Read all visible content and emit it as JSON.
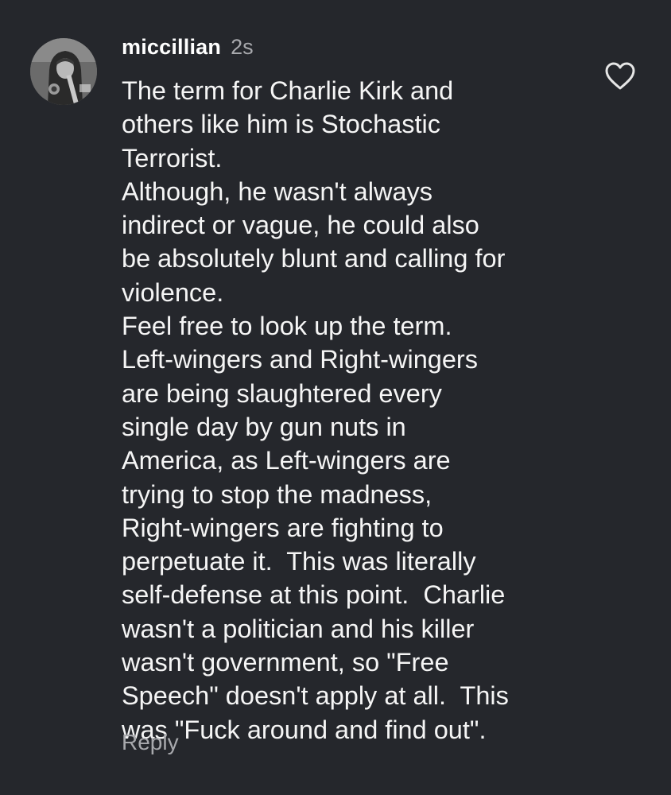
{
  "comment": {
    "username": "miccillian",
    "timestamp": "2s",
    "lines": [
      "The term for Charlie Kirk and",
      "others like him is Stochastic",
      "Terrorist.",
      "Although, he wasn't always",
      "indirect or vague, he could also",
      "be absolutely blunt and calling for",
      "violence.",
      "Feel free to look up the term.",
      "Left-wingers and Right-wingers",
      "are being slaughtered every",
      "single day by gun nuts in",
      "America, as Left-wingers are",
      "trying to stop the madness,",
      "Right-wingers are fighting to",
      "perpetuate it.  This was literally",
      "self-defense at this point.  Charlie",
      "wasn't a politician and his killer",
      "wasn't government, so \"Free",
      "Speech\" doesn't apply at all.  This",
      "was \"Fuck around and find out\"."
    ],
    "reply_label": "Reply",
    "like_icon": "heart-outline-icon"
  },
  "colors": {
    "background": "#25272c",
    "text": "#f5f5f5",
    "muted": "#a8a9ad"
  }
}
